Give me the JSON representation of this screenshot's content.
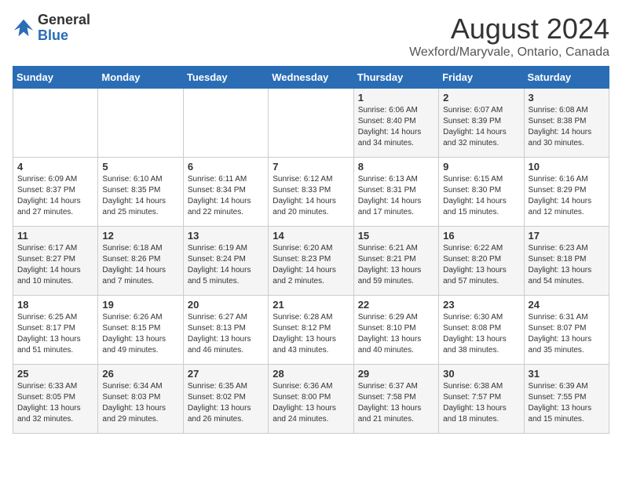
{
  "logo": {
    "general": "General",
    "blue": "Blue"
  },
  "title": "August 2024",
  "subtitle": "Wexford/Maryvale, Ontario, Canada",
  "headers": [
    "Sunday",
    "Monday",
    "Tuesday",
    "Wednesday",
    "Thursday",
    "Friday",
    "Saturday"
  ],
  "weeks": [
    [
      {
        "day": "",
        "sunrise": "",
        "sunset": "",
        "daylight": ""
      },
      {
        "day": "",
        "sunrise": "",
        "sunset": "",
        "daylight": ""
      },
      {
        "day": "",
        "sunrise": "",
        "sunset": "",
        "daylight": ""
      },
      {
        "day": "",
        "sunrise": "",
        "sunset": "",
        "daylight": ""
      },
      {
        "day": "1",
        "sunrise": "Sunrise: 6:06 AM",
        "sunset": "Sunset: 8:40 PM",
        "daylight": "Daylight: 14 hours and 34 minutes."
      },
      {
        "day": "2",
        "sunrise": "Sunrise: 6:07 AM",
        "sunset": "Sunset: 8:39 PM",
        "daylight": "Daylight: 14 hours and 32 minutes."
      },
      {
        "day": "3",
        "sunrise": "Sunrise: 6:08 AM",
        "sunset": "Sunset: 8:38 PM",
        "daylight": "Daylight: 14 hours and 30 minutes."
      }
    ],
    [
      {
        "day": "4",
        "sunrise": "Sunrise: 6:09 AM",
        "sunset": "Sunset: 8:37 PM",
        "daylight": "Daylight: 14 hours and 27 minutes."
      },
      {
        "day": "5",
        "sunrise": "Sunrise: 6:10 AM",
        "sunset": "Sunset: 8:35 PM",
        "daylight": "Daylight: 14 hours and 25 minutes."
      },
      {
        "day": "6",
        "sunrise": "Sunrise: 6:11 AM",
        "sunset": "Sunset: 8:34 PM",
        "daylight": "Daylight: 14 hours and 22 minutes."
      },
      {
        "day": "7",
        "sunrise": "Sunrise: 6:12 AM",
        "sunset": "Sunset: 8:33 PM",
        "daylight": "Daylight: 14 hours and 20 minutes."
      },
      {
        "day": "8",
        "sunrise": "Sunrise: 6:13 AM",
        "sunset": "Sunset: 8:31 PM",
        "daylight": "Daylight: 14 hours and 17 minutes."
      },
      {
        "day": "9",
        "sunrise": "Sunrise: 6:15 AM",
        "sunset": "Sunset: 8:30 PM",
        "daylight": "Daylight: 14 hours and 15 minutes."
      },
      {
        "day": "10",
        "sunrise": "Sunrise: 6:16 AM",
        "sunset": "Sunset: 8:29 PM",
        "daylight": "Daylight: 14 hours and 12 minutes."
      }
    ],
    [
      {
        "day": "11",
        "sunrise": "Sunrise: 6:17 AM",
        "sunset": "Sunset: 8:27 PM",
        "daylight": "Daylight: 14 hours and 10 minutes."
      },
      {
        "day": "12",
        "sunrise": "Sunrise: 6:18 AM",
        "sunset": "Sunset: 8:26 PM",
        "daylight": "Daylight: 14 hours and 7 minutes."
      },
      {
        "day": "13",
        "sunrise": "Sunrise: 6:19 AM",
        "sunset": "Sunset: 8:24 PM",
        "daylight": "Daylight: 14 hours and 5 minutes."
      },
      {
        "day": "14",
        "sunrise": "Sunrise: 6:20 AM",
        "sunset": "Sunset: 8:23 PM",
        "daylight": "Daylight: 14 hours and 2 minutes."
      },
      {
        "day": "15",
        "sunrise": "Sunrise: 6:21 AM",
        "sunset": "Sunset: 8:21 PM",
        "daylight": "Daylight: 13 hours and 59 minutes."
      },
      {
        "day": "16",
        "sunrise": "Sunrise: 6:22 AM",
        "sunset": "Sunset: 8:20 PM",
        "daylight": "Daylight: 13 hours and 57 minutes."
      },
      {
        "day": "17",
        "sunrise": "Sunrise: 6:23 AM",
        "sunset": "Sunset: 8:18 PM",
        "daylight": "Daylight: 13 hours and 54 minutes."
      }
    ],
    [
      {
        "day": "18",
        "sunrise": "Sunrise: 6:25 AM",
        "sunset": "Sunset: 8:17 PM",
        "daylight": "Daylight: 13 hours and 51 minutes."
      },
      {
        "day": "19",
        "sunrise": "Sunrise: 6:26 AM",
        "sunset": "Sunset: 8:15 PM",
        "daylight": "Daylight: 13 hours and 49 minutes."
      },
      {
        "day": "20",
        "sunrise": "Sunrise: 6:27 AM",
        "sunset": "Sunset: 8:13 PM",
        "daylight": "Daylight: 13 hours and 46 minutes."
      },
      {
        "day": "21",
        "sunrise": "Sunrise: 6:28 AM",
        "sunset": "Sunset: 8:12 PM",
        "daylight": "Daylight: 13 hours and 43 minutes."
      },
      {
        "day": "22",
        "sunrise": "Sunrise: 6:29 AM",
        "sunset": "Sunset: 8:10 PM",
        "daylight": "Daylight: 13 hours and 40 minutes."
      },
      {
        "day": "23",
        "sunrise": "Sunrise: 6:30 AM",
        "sunset": "Sunset: 8:08 PM",
        "daylight": "Daylight: 13 hours and 38 minutes."
      },
      {
        "day": "24",
        "sunrise": "Sunrise: 6:31 AM",
        "sunset": "Sunset: 8:07 PM",
        "daylight": "Daylight: 13 hours and 35 minutes."
      }
    ],
    [
      {
        "day": "25",
        "sunrise": "Sunrise: 6:33 AM",
        "sunset": "Sunset: 8:05 PM",
        "daylight": "Daylight: 13 hours and 32 minutes."
      },
      {
        "day": "26",
        "sunrise": "Sunrise: 6:34 AM",
        "sunset": "Sunset: 8:03 PM",
        "daylight": "Daylight: 13 hours and 29 minutes."
      },
      {
        "day": "27",
        "sunrise": "Sunrise: 6:35 AM",
        "sunset": "Sunset: 8:02 PM",
        "daylight": "Daylight: 13 hours and 26 minutes."
      },
      {
        "day": "28",
        "sunrise": "Sunrise: 6:36 AM",
        "sunset": "Sunset: 8:00 PM",
        "daylight": "Daylight: 13 hours and 24 minutes."
      },
      {
        "day": "29",
        "sunrise": "Sunrise: 6:37 AM",
        "sunset": "Sunset: 7:58 PM",
        "daylight": "Daylight: 13 hours and 21 minutes."
      },
      {
        "day": "30",
        "sunrise": "Sunrise: 6:38 AM",
        "sunset": "Sunset: 7:57 PM",
        "daylight": "Daylight: 13 hours and 18 minutes."
      },
      {
        "day": "31",
        "sunrise": "Sunrise: 6:39 AM",
        "sunset": "Sunset: 7:55 PM",
        "daylight": "Daylight: 13 hours and 15 minutes."
      }
    ]
  ]
}
